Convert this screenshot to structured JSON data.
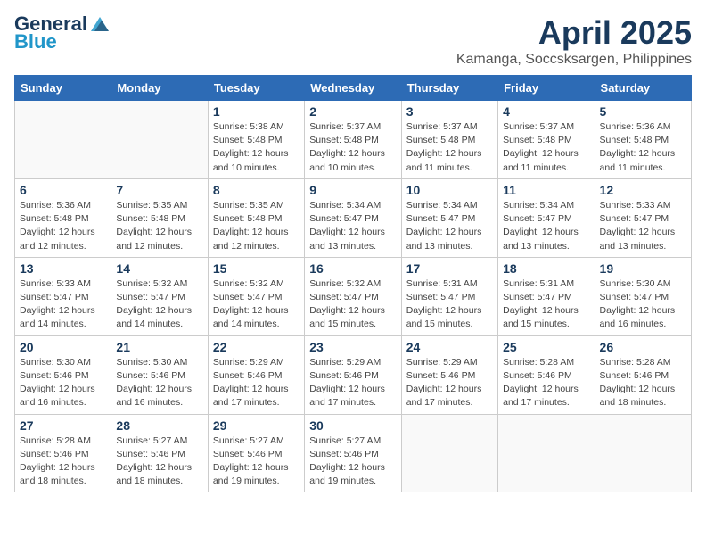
{
  "header": {
    "logo_general": "General",
    "logo_blue": "Blue",
    "title": "April 2025",
    "subtitle": "Kamanga, Soccsksargen, Philippines"
  },
  "days_of_week": [
    "Sunday",
    "Monday",
    "Tuesday",
    "Wednesday",
    "Thursday",
    "Friday",
    "Saturday"
  ],
  "weeks": [
    [
      {
        "day": "",
        "detail": ""
      },
      {
        "day": "",
        "detail": ""
      },
      {
        "day": "1",
        "detail": "Sunrise: 5:38 AM\nSunset: 5:48 PM\nDaylight: 12 hours and 10 minutes."
      },
      {
        "day": "2",
        "detail": "Sunrise: 5:37 AM\nSunset: 5:48 PM\nDaylight: 12 hours and 10 minutes."
      },
      {
        "day": "3",
        "detail": "Sunrise: 5:37 AM\nSunset: 5:48 PM\nDaylight: 12 hours and 11 minutes."
      },
      {
        "day": "4",
        "detail": "Sunrise: 5:37 AM\nSunset: 5:48 PM\nDaylight: 12 hours and 11 minutes."
      },
      {
        "day": "5",
        "detail": "Sunrise: 5:36 AM\nSunset: 5:48 PM\nDaylight: 12 hours and 11 minutes."
      }
    ],
    [
      {
        "day": "6",
        "detail": "Sunrise: 5:36 AM\nSunset: 5:48 PM\nDaylight: 12 hours and 12 minutes."
      },
      {
        "day": "7",
        "detail": "Sunrise: 5:35 AM\nSunset: 5:48 PM\nDaylight: 12 hours and 12 minutes."
      },
      {
        "day": "8",
        "detail": "Sunrise: 5:35 AM\nSunset: 5:48 PM\nDaylight: 12 hours and 12 minutes."
      },
      {
        "day": "9",
        "detail": "Sunrise: 5:34 AM\nSunset: 5:47 PM\nDaylight: 12 hours and 13 minutes."
      },
      {
        "day": "10",
        "detail": "Sunrise: 5:34 AM\nSunset: 5:47 PM\nDaylight: 12 hours and 13 minutes."
      },
      {
        "day": "11",
        "detail": "Sunrise: 5:34 AM\nSunset: 5:47 PM\nDaylight: 12 hours and 13 minutes."
      },
      {
        "day": "12",
        "detail": "Sunrise: 5:33 AM\nSunset: 5:47 PM\nDaylight: 12 hours and 13 minutes."
      }
    ],
    [
      {
        "day": "13",
        "detail": "Sunrise: 5:33 AM\nSunset: 5:47 PM\nDaylight: 12 hours and 14 minutes."
      },
      {
        "day": "14",
        "detail": "Sunrise: 5:32 AM\nSunset: 5:47 PM\nDaylight: 12 hours and 14 minutes."
      },
      {
        "day": "15",
        "detail": "Sunrise: 5:32 AM\nSunset: 5:47 PM\nDaylight: 12 hours and 14 minutes."
      },
      {
        "day": "16",
        "detail": "Sunrise: 5:32 AM\nSunset: 5:47 PM\nDaylight: 12 hours and 15 minutes."
      },
      {
        "day": "17",
        "detail": "Sunrise: 5:31 AM\nSunset: 5:47 PM\nDaylight: 12 hours and 15 minutes."
      },
      {
        "day": "18",
        "detail": "Sunrise: 5:31 AM\nSunset: 5:47 PM\nDaylight: 12 hours and 15 minutes."
      },
      {
        "day": "19",
        "detail": "Sunrise: 5:30 AM\nSunset: 5:47 PM\nDaylight: 12 hours and 16 minutes."
      }
    ],
    [
      {
        "day": "20",
        "detail": "Sunrise: 5:30 AM\nSunset: 5:46 PM\nDaylight: 12 hours and 16 minutes."
      },
      {
        "day": "21",
        "detail": "Sunrise: 5:30 AM\nSunset: 5:46 PM\nDaylight: 12 hours and 16 minutes."
      },
      {
        "day": "22",
        "detail": "Sunrise: 5:29 AM\nSunset: 5:46 PM\nDaylight: 12 hours and 17 minutes."
      },
      {
        "day": "23",
        "detail": "Sunrise: 5:29 AM\nSunset: 5:46 PM\nDaylight: 12 hours and 17 minutes."
      },
      {
        "day": "24",
        "detail": "Sunrise: 5:29 AM\nSunset: 5:46 PM\nDaylight: 12 hours and 17 minutes."
      },
      {
        "day": "25",
        "detail": "Sunrise: 5:28 AM\nSunset: 5:46 PM\nDaylight: 12 hours and 17 minutes."
      },
      {
        "day": "26",
        "detail": "Sunrise: 5:28 AM\nSunset: 5:46 PM\nDaylight: 12 hours and 18 minutes."
      }
    ],
    [
      {
        "day": "27",
        "detail": "Sunrise: 5:28 AM\nSunset: 5:46 PM\nDaylight: 12 hours and 18 minutes."
      },
      {
        "day": "28",
        "detail": "Sunrise: 5:27 AM\nSunset: 5:46 PM\nDaylight: 12 hours and 18 minutes."
      },
      {
        "day": "29",
        "detail": "Sunrise: 5:27 AM\nSunset: 5:46 PM\nDaylight: 12 hours and 19 minutes."
      },
      {
        "day": "30",
        "detail": "Sunrise: 5:27 AM\nSunset: 5:46 PM\nDaylight: 12 hours and 19 minutes."
      },
      {
        "day": "",
        "detail": ""
      },
      {
        "day": "",
        "detail": ""
      },
      {
        "day": "",
        "detail": ""
      }
    ]
  ]
}
